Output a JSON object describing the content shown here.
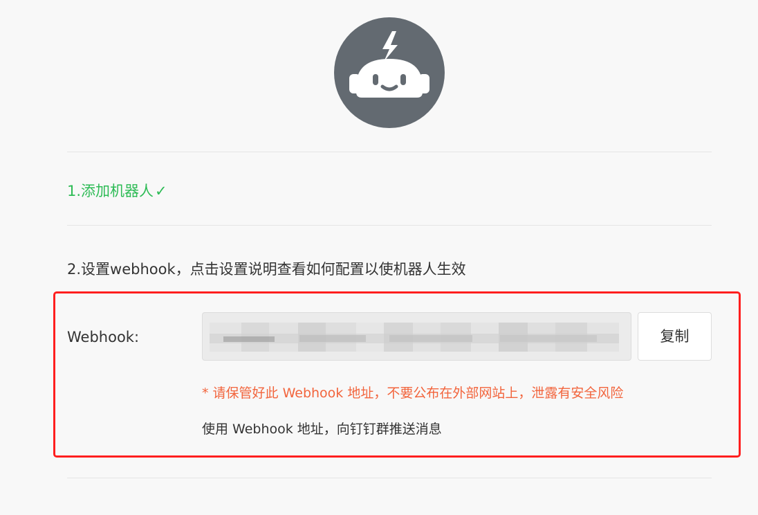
{
  "colors": {
    "background": "#f8f8f8",
    "avatar": "#636a71",
    "success": "#2dbb55",
    "warning": "#f2643c",
    "highlight_border": "#ff1f1f",
    "divider": "#e5e5e5",
    "input_background": "#ebebeb"
  },
  "header": {
    "avatar_icon": "robot-icon"
  },
  "steps": {
    "step1": {
      "label": "1.添加机器人",
      "status_icon": "check-icon",
      "status_glyph": "✓"
    },
    "step2": {
      "label": "2.设置webhook，点击设置说明查看如何配置以使机器人生效"
    }
  },
  "webhook": {
    "label": "Webhook:",
    "value_obscured": true,
    "copy_label": "复制",
    "warning": "* 请保管好此 Webhook 地址，不要公布在外部网站上，泄露有安全风险",
    "usage": "使用 Webhook 地址，向钉钉群推送消息"
  }
}
